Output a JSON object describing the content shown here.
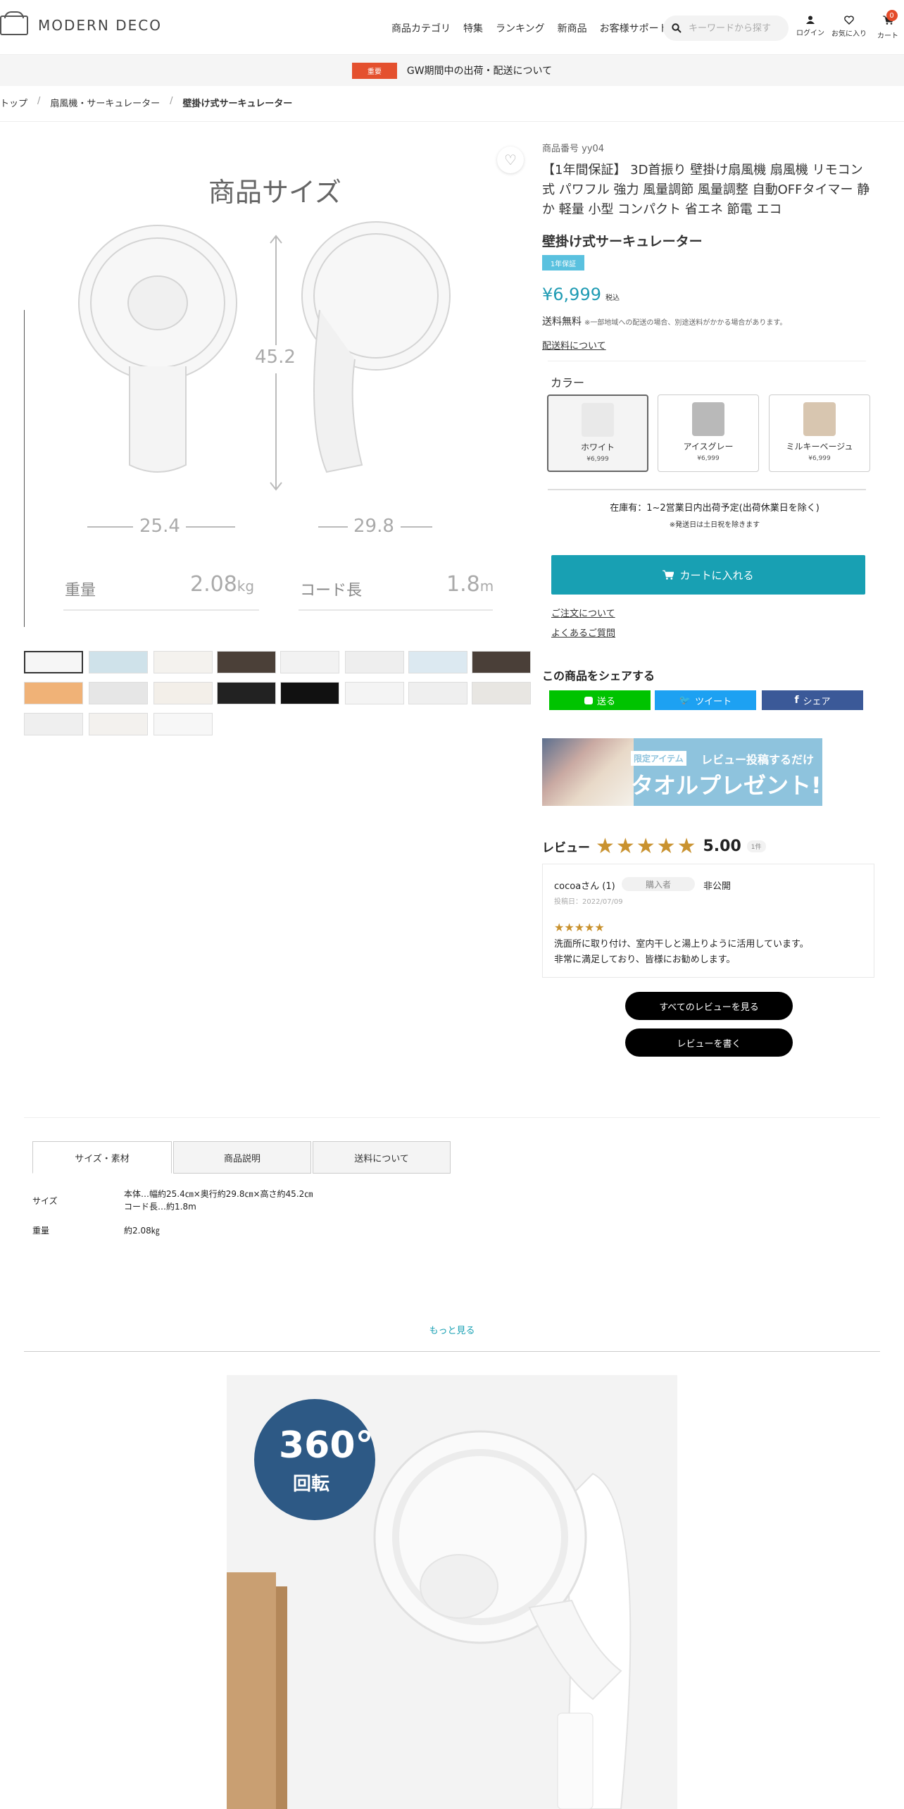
{
  "header": {
    "logo_text": "MODERN DECO",
    "nav": [
      "商品カテゴリ",
      "特集",
      "ランキング",
      "新商品",
      "お客様サポート"
    ],
    "search_placeholder": "キーワードから探す",
    "login": "ログイン",
    "favorites": "お気に入り",
    "cart": "カート",
    "cart_count": "0"
  },
  "notice": {
    "tag": "重要",
    "text": "GW期間中の出荷・配送について"
  },
  "breadcrumb": [
    "トップ",
    "扇風機・サーキュレーター",
    "壁掛け式サーキュレーター"
  ],
  "main_image": {
    "title": "商品サイズ",
    "height": "45.2",
    "width1": "25.4",
    "width2": "29.8",
    "weight_label": "重量",
    "weight_value": "2.08",
    "weight_unit": "kg",
    "cord_label": "コード長",
    "cord_value": "1.8",
    "cord_unit": "m"
  },
  "product": {
    "code": "商品番号 yy04",
    "title": "【1年間保証】 3D首振り 壁掛け扇風機 扇風機 リモコン式 パワフル 強力 風量調節 風量調整 自動OFFタイマー 静か 軽量 小型 コンパクト 省エネ 節電 エコ",
    "name": "壁掛け式サーキュレーター",
    "warranty_badge": "1年保証",
    "price": "¥6,999",
    "tax": "税込",
    "shipping": "送料無料",
    "shipping_note": "※一部地域への配送の場合、別途送料がかかる場合があります。",
    "shipping_link": "配送料について",
    "color_label": "カラー",
    "colors": [
      {
        "name": "ホワイト",
        "price": "¥6,999",
        "swatch": "#e9e9e9"
      },
      {
        "name": "アイスグレー",
        "price": "¥6,999",
        "swatch": "#b9b9b9"
      },
      {
        "name": "ミルキーベージュ",
        "price": "¥6,999",
        "swatch": "#d8c6b0"
      }
    ],
    "stock": "在庫有：1~2営業日内出荷予定(出荷休業日を除く)",
    "stock_note": "※発送日は土日祝を除きます",
    "cart_button": "カートに入れる",
    "order_link": "ご注文について",
    "faq_link": "よくあるご質問"
  },
  "share": {
    "title": "この商品をシェアする",
    "line": "送る",
    "twitter": "ツイート",
    "facebook": "シェア"
  },
  "banner": {
    "tag": "限定アイテム",
    "line1": "レビュー投稿するだけ",
    "line2": "タオルプレゼント!"
  },
  "reviews": {
    "title": "レビュー",
    "score": "5.00",
    "count": "1件",
    "user": "cocoaさん (1)",
    "buyer": "購入者",
    "privacy": "非公開",
    "date": "投稿日：2022/07/09",
    "line1": "洗面所に取り付け、室内干しと湯上りように活用しています。",
    "line2": "非常に満足しており、皆様にお勧めします。",
    "all_button": "すべてのレビューを見る",
    "write_button": "レビューを書く"
  },
  "tabs": [
    "サイズ・素材",
    "商品説明",
    "送料について"
  ],
  "specs": {
    "size_label": "サイズ",
    "size_line1": "本体…幅約25.4㎝×奥行約29.8㎝×高さ約45.2㎝",
    "size_line2": "コード長…約1.8m",
    "weight_label": "重量",
    "weight_value": "約2.08㎏"
  },
  "more": "もっと見る",
  "bottom_image": {
    "badge_big": "360°",
    "badge_small": "回転"
  },
  "colors": {
    "accent": "#18a0b3",
    "notice": "#e4502e",
    "star": "#c9922f"
  }
}
